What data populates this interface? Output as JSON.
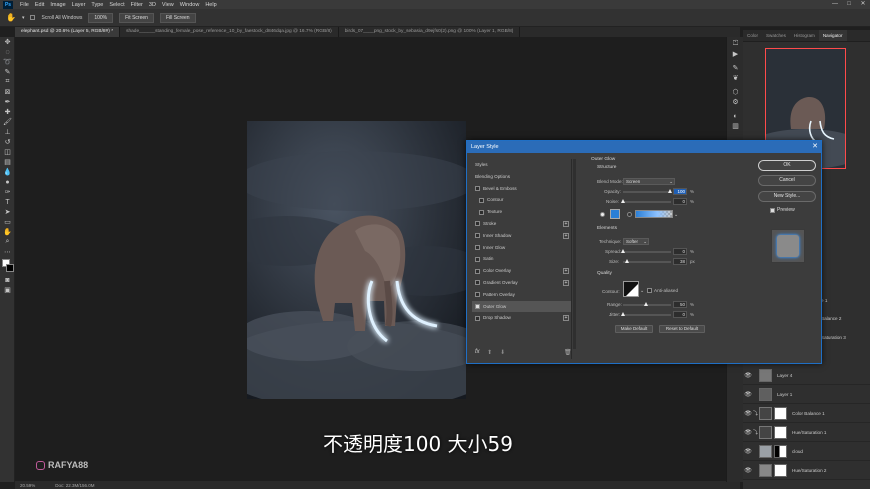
{
  "menubar": {
    "logo": "Ps",
    "items": [
      "File",
      "Edit",
      "Image",
      "Layer",
      "Type",
      "Select",
      "Filter",
      "3D",
      "View",
      "Window",
      "Help"
    ],
    "window_controls": [
      "—",
      "□",
      "✕"
    ]
  },
  "options_bar": {
    "scroll_all_windows": "Scroll All Windows",
    "zoom_100": "100%",
    "fit_screen": "Fit Screen",
    "fill_screen": "Fill Screen"
  },
  "tabs": [
    {
      "label": "elephant.psd @ 20.6% (Layer 5, RGB/8#) *",
      "active": true
    },
    {
      "label": "shade______standing_female_pose_reference_10_by_faestock_d846dqa.jpg @ 16.7% (RGB/8)",
      "active": false
    },
    {
      "label": "birds_07____png_stock_by_sebasia_d9ejfs0(2).png @ 100% (Layer 1, RGB/8)",
      "active": false
    }
  ],
  "status": {
    "zoom": "20.59%",
    "doc": "Doc: 22.3M/156.0M"
  },
  "panel_tabs": [
    {
      "label": "Color",
      "active": false
    },
    {
      "label": "Swatches",
      "active": false
    },
    {
      "label": "Histogram",
      "active": false
    },
    {
      "label": "Navigator",
      "active": true
    }
  ],
  "layers": [
    {
      "name": "Layer 4",
      "thumb": "gray"
    },
    {
      "name": "Layer 1",
      "thumb": "gray"
    },
    {
      "name": "Color Balance 1",
      "thumb": "adj"
    },
    {
      "name": "Hue/Saturation 1",
      "thumb": "adj"
    },
    {
      "name": "cloud",
      "thumb": "white"
    },
    {
      "name": "Hue/Saturation 2",
      "thumb": "adj"
    }
  ],
  "layers_partial": [
    "e 1",
    "Balance 2",
    "Saturation 3"
  ],
  "dialog": {
    "title": "Layer Style",
    "close": "✕",
    "styles": [
      {
        "label": "Styles",
        "cb": false,
        "checked": false,
        "indent": false,
        "plus": false,
        "selected": false
      },
      {
        "label": "Blending Options",
        "cb": false,
        "checked": false,
        "indent": false,
        "plus": false,
        "selected": false
      },
      {
        "label": "Bevel & Emboss",
        "cb": true,
        "checked": false,
        "indent": false,
        "plus": false,
        "selected": false
      },
      {
        "label": "Contour",
        "cb": true,
        "checked": false,
        "indent": true,
        "plus": false,
        "selected": false
      },
      {
        "label": "Texture",
        "cb": true,
        "checked": false,
        "indent": true,
        "plus": false,
        "selected": false
      },
      {
        "label": "Stroke",
        "cb": true,
        "checked": false,
        "indent": false,
        "plus": true,
        "selected": false
      },
      {
        "label": "Inner Shadow",
        "cb": true,
        "checked": false,
        "indent": false,
        "plus": true,
        "selected": false
      },
      {
        "label": "Inner Glow",
        "cb": true,
        "checked": false,
        "indent": false,
        "plus": false,
        "selected": false
      },
      {
        "label": "Satin",
        "cb": true,
        "checked": false,
        "indent": false,
        "plus": false,
        "selected": false
      },
      {
        "label": "Color Overlay",
        "cb": true,
        "checked": false,
        "indent": false,
        "plus": true,
        "selected": false
      },
      {
        "label": "Gradient Overlay",
        "cb": true,
        "checked": false,
        "indent": false,
        "plus": true,
        "selected": false
      },
      {
        "label": "Pattern Overlay",
        "cb": true,
        "checked": false,
        "indent": false,
        "plus": false,
        "selected": false
      },
      {
        "label": "Outer Glow",
        "cb": true,
        "checked": true,
        "indent": false,
        "plus": false,
        "selected": true
      },
      {
        "label": "Drop Shadow",
        "cb": true,
        "checked": false,
        "indent": false,
        "plus": true,
        "selected": false
      }
    ],
    "footer_fx": "fx",
    "outer_glow": {
      "title": "Outer Glow",
      "structure": "Structure",
      "blend_mode_label": "Blend Mode:",
      "blend_mode": "Screen",
      "opacity_label": "Opacity:",
      "opacity": "100",
      "noise_label": "Noise:",
      "noise": "0",
      "percent": "%",
      "elements": "Elements",
      "technique_label": "Technique:",
      "technique": "Softer",
      "spread_label": "Spread:",
      "spread": "0",
      "size_label": "Size:",
      "size": "38",
      "px": "px",
      "quality": "Quality",
      "contour_label": "Contour:",
      "anti_aliased": "Anti-aliased",
      "range_label": "Range:",
      "range": "50",
      "jitter_label": "Jitter:",
      "jitter": "0",
      "make_default": "Make Default",
      "reset_default": "Reset to Default",
      "glow_color": "#2b7fd6"
    },
    "buttons": {
      "ok": "OK",
      "cancel": "Cancel",
      "new_style": "New Style...",
      "preview": "Preview"
    }
  },
  "subtitle": "不透明度100 大小59",
  "watermark": "RAFYA88"
}
